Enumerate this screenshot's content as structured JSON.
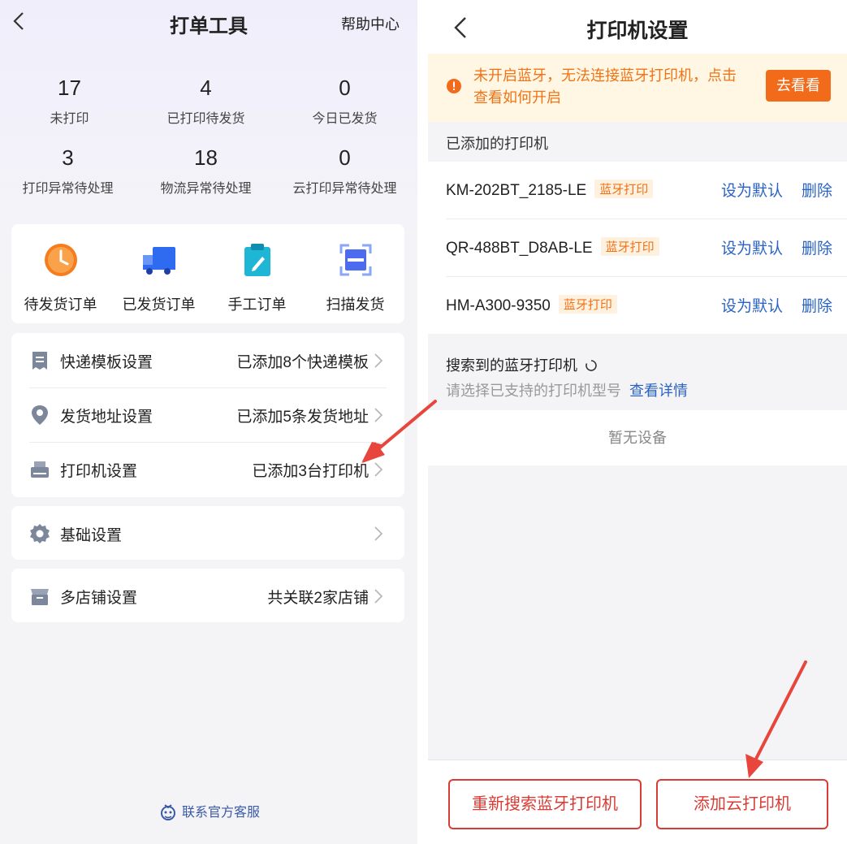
{
  "left": {
    "title": "打单工具",
    "help": "帮助中心",
    "stats": [
      {
        "num": "17",
        "label": "未打印"
      },
      {
        "num": "4",
        "label": "已打印待发货"
      },
      {
        "num": "0",
        "label": "今日已发货"
      },
      {
        "num": "3",
        "label": "打印异常待处理"
      },
      {
        "num": "18",
        "label": "物流异常待处理"
      },
      {
        "num": "0",
        "label": "云打印异常待处理"
      }
    ],
    "quick": [
      {
        "label": "待发货订单",
        "icon": "clock-icon",
        "color": "#f57c1f"
      },
      {
        "label": "已发货订单",
        "icon": "truck-icon",
        "color": "#2f6bf0"
      },
      {
        "label": "手工订单",
        "icon": "clipboard-pen-icon",
        "color": "#1fb6d6"
      },
      {
        "label": "扫描发货",
        "icon": "scan-icon",
        "color": "#4c6bf0"
      }
    ],
    "menu": [
      {
        "label": "快递模板设置",
        "value": "已添加8个快递模板"
      },
      {
        "label": "发货地址设置",
        "value": "已添加5条发货地址"
      },
      {
        "label": "打印机设置",
        "value": "已添加3台打印机"
      },
      {
        "label": "基础设置",
        "value": ""
      },
      {
        "label": "多店铺设置",
        "value": "共关联2家店铺"
      }
    ],
    "contact": "联系官方客服"
  },
  "right": {
    "title": "打印机设置",
    "warning": {
      "text": "未开启蓝牙，无法连接蓝牙打印机，点击查看如何开启",
      "button": "去看看"
    },
    "added_title": "已添加的打印机",
    "printers": [
      {
        "name": "KM-202BT_2185-LE",
        "tag": "蓝牙打印",
        "set_default": "设为默认",
        "delete": "删除"
      },
      {
        "name": "QR-488BT_D8AB-LE",
        "tag": "蓝牙打印",
        "set_default": "设为默认",
        "delete": "删除"
      },
      {
        "name": "HM-A300-9350",
        "tag": "蓝牙打印",
        "set_default": "设为默认",
        "delete": "删除"
      }
    ],
    "search_title": "搜索到的蓝牙打印机",
    "search_sub": "请选择已支持的打印机型号",
    "search_link": "查看详情",
    "no_device": "暂无设备",
    "btn_research": "重新搜索蓝牙打印机",
    "btn_add_cloud": "添加云打印机"
  },
  "colors": {
    "accent_orange": "#f26b1a",
    "link_blue": "#2a63c6",
    "danger_red": "#d93b35",
    "annotation_arrow": "#e8453c"
  }
}
